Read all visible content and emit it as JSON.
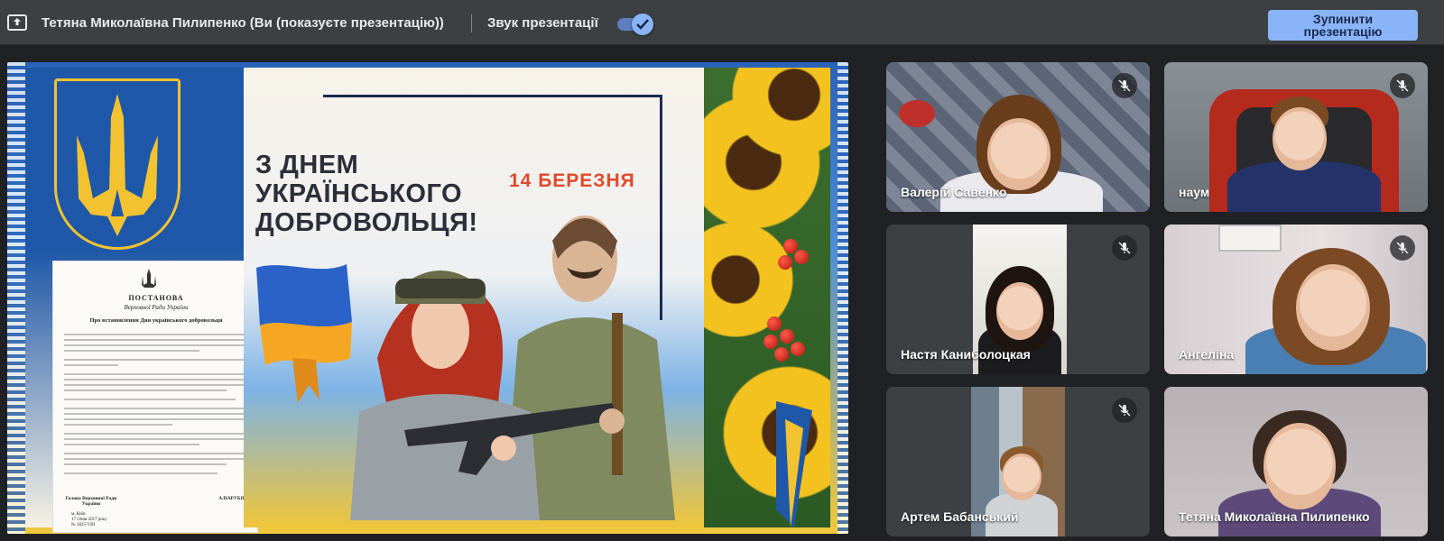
{
  "topbar": {
    "presenter": "Тетяна Миколаївна Пилипенко (Ви (показуєте презентацію))",
    "sound_label": "Звук презентації",
    "sound_enabled": true,
    "stop_button": [
      "Зупинити",
      "презентацію"
    ],
    "present_icon": "present-to-all-icon"
  },
  "slide": {
    "headline": [
      "З ДНЕМ",
      "УКРАЇНСЬКОГО",
      "ДОБРОВОЛЬЦЯ!"
    ],
    "date": "14 БЕРЕЗНЯ",
    "document": {
      "title": "ПОСТАНОВА",
      "subtitle": "Верховної Ради України",
      "heading": "Про встановлення Дня українського добровольця",
      "sign_left": "Голова Верховної Ради України",
      "sign_right": "А.ПАРУБІЙ",
      "footer": [
        "м. Київ",
        "17 січня 2017 року",
        "№ 1835-VIII"
      ]
    },
    "colors": {
      "blue": "#1f58a8",
      "yellow": "#f2c230",
      "red": "#e0492b"
    }
  },
  "participants": [
    {
      "name": "Валерій Савенко",
      "muted": true
    },
    {
      "name": "наум",
      "muted": true
    },
    {
      "name": "Настя Каниболоцкая",
      "muted": true
    },
    {
      "name": "Ангеліна",
      "muted": true
    },
    {
      "name": "Артем Бабанський",
      "muted": true
    },
    {
      "name": "Тетяна Миколаївна Пилипенко",
      "muted": false
    }
  ]
}
